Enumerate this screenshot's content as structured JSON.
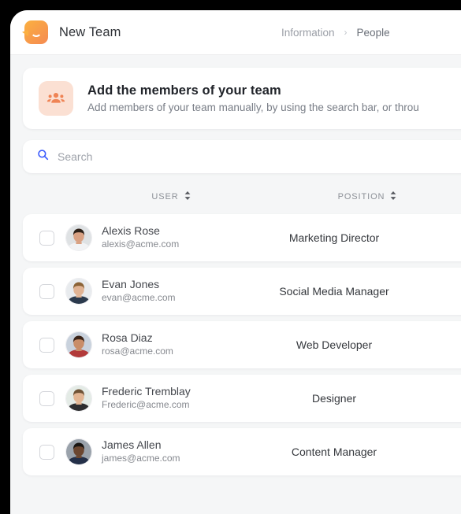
{
  "window": {
    "background_color": "#000000",
    "surface_color": "#f5f6f7"
  },
  "header": {
    "logo_icon": "smile-chat-logo-icon",
    "team_name": "New Team",
    "breadcrumb": {
      "parent": "Information",
      "separator": "›",
      "current": "People"
    }
  },
  "banner": {
    "icon": "group-people-icon",
    "icon_bg_color": "#fbe0d3",
    "icon_color": "#ef8354",
    "title": "Add the members of your team",
    "subtitle": "Add members of your team manually, by using the search bar, or throu"
  },
  "search": {
    "icon": "search-icon",
    "icon_color": "#3b5bfd",
    "placeholder": "Search",
    "value": ""
  },
  "table": {
    "columns": [
      {
        "label": "USER",
        "sort_icon": "sort-updown-icon"
      },
      {
        "label": "POSITION",
        "sort_icon": "sort-updown-icon"
      }
    ],
    "rows": [
      {
        "checked": false,
        "avatar": "avatar-alexis",
        "name": "Alexis Rose",
        "email": "alexis@acme.com",
        "position": "Marketing Director"
      },
      {
        "checked": false,
        "avatar": "avatar-evan",
        "name": "Evan Jones",
        "email": "evan@acme.com",
        "position": "Social Media Manager"
      },
      {
        "checked": false,
        "avatar": "avatar-rosa",
        "name": "Rosa Diaz",
        "email": "rosa@acme.com",
        "position": "Web Developer"
      },
      {
        "checked": false,
        "avatar": "avatar-frederic",
        "name": "Frederic Tremblay",
        "email": "Frederic@acme.com",
        "position": "Designer"
      },
      {
        "checked": false,
        "avatar": "avatar-james",
        "name": "James Allen",
        "email": "james@acme.com",
        "position": "Content Manager"
      }
    ]
  }
}
